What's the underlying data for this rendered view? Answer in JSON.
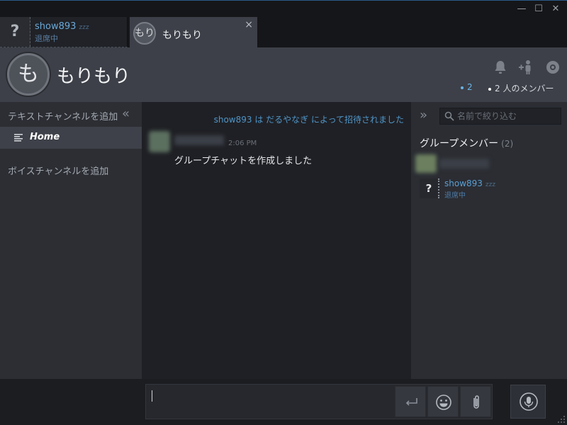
{
  "window": {
    "controls": {
      "minimize": "—",
      "maximize": "☐",
      "close": "✕"
    }
  },
  "tabs": [
    {
      "avatar": "?",
      "name": "show893",
      "status": "退席中",
      "away": "zzz"
    },
    {
      "avatar": "もり",
      "name": "もりもり",
      "close": "×"
    }
  ],
  "header": {
    "avatar": "も",
    "title": "もりもり",
    "online_count": "2",
    "member_count": "2 人のメンバー"
  },
  "sidebar": {
    "add_text_channel": "テキストチャンネルを追加",
    "collapse": "«",
    "channels": [
      {
        "label": "Home"
      }
    ],
    "add_voice_channel": "ボイスチャンネルを追加"
  },
  "chat": {
    "system_message": "show893 は だるやなぎ によって招待されました",
    "messages": [
      {
        "time": "2:06 PM",
        "text": "グループチャットを作成しました"
      }
    ]
  },
  "members": {
    "expand": "»",
    "filter_placeholder": "名前で絞り込む",
    "heading": "グループメンバー",
    "count": "(2)",
    "list": [
      {
        "name": "show893",
        "status": "退席中",
        "avatar": "?",
        "away": "zzz"
      }
    ]
  },
  "colors": {
    "accent": "#4f95c8",
    "online_dot": "#6ab4e8",
    "background": "#1f2025",
    "header": "#3d4048"
  }
}
